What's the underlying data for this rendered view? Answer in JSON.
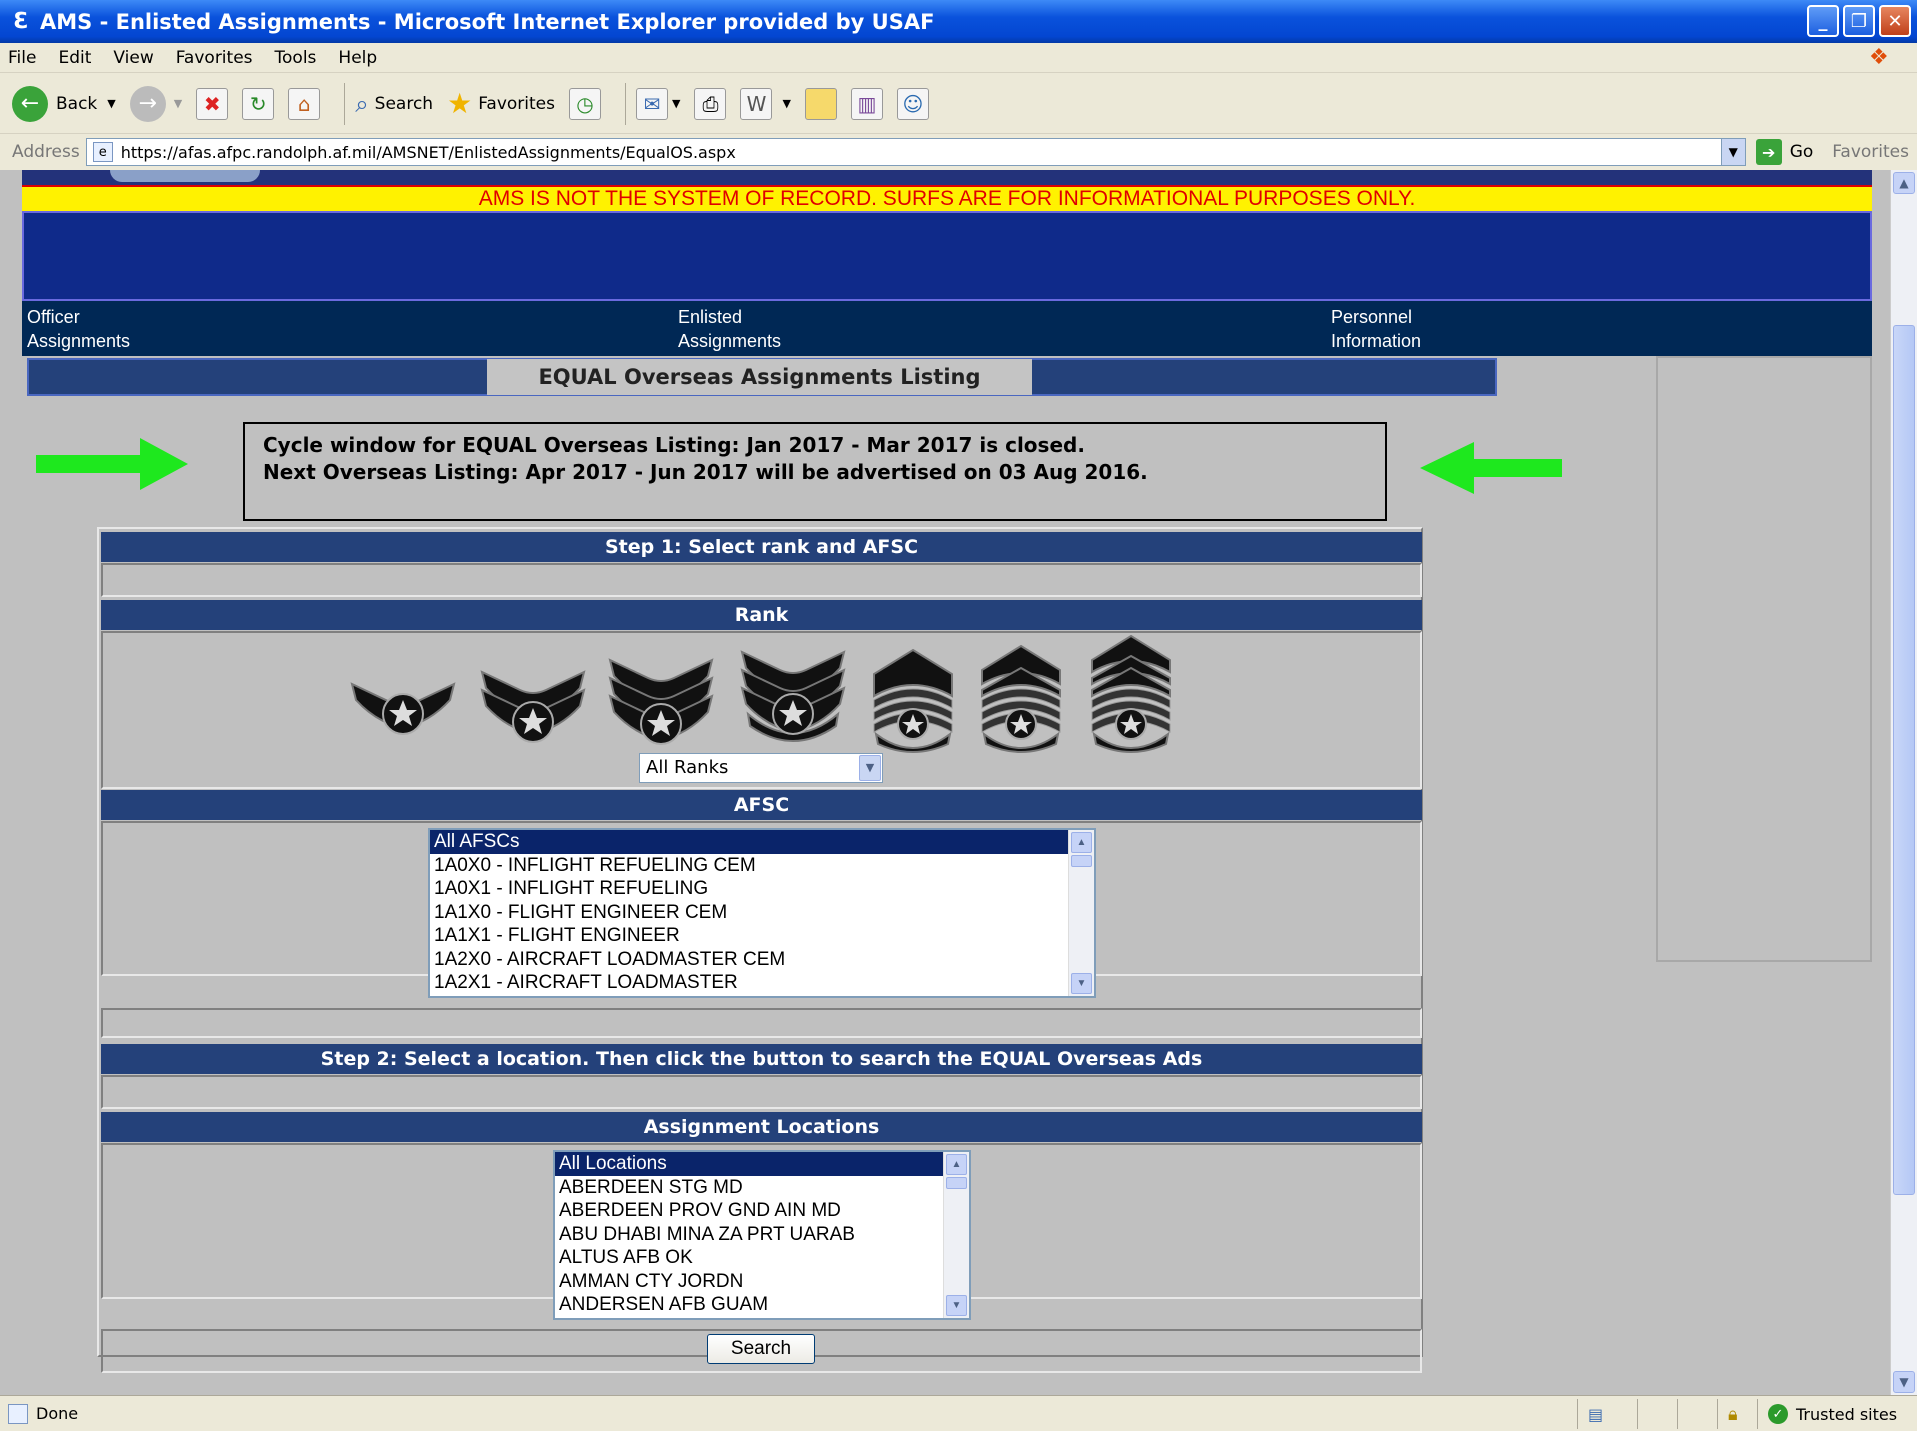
{
  "window": {
    "title": "AMS - Enlisted Assignments - Microsoft Internet Explorer provided by USAF"
  },
  "menu": [
    "File",
    "Edit",
    "View",
    "Favorites",
    "Tools",
    "Help"
  ],
  "toolbar": {
    "back": "Back",
    "search": "Search",
    "favorites": "Favorites"
  },
  "address": {
    "label": "Address",
    "url": "https://afas.afpc.randolph.af.mil/AMSNET/EnlistedAssignments/EqualOS.aspx",
    "go": "Go",
    "favorites": "Favorites"
  },
  "page": {
    "warning": "AMS IS NOT THE SYSTEM OF RECORD. SURFS ARE FOR INFORMATIONAL PURPOSES ONLY.",
    "nav": [
      {
        "line1": "Officer",
        "line2": "Assignments"
      },
      {
        "line1": "Enlisted",
        "line2": "Assignments"
      },
      {
        "line1": "Personnel",
        "line2": "Information"
      }
    ],
    "title": "EQUAL Overseas Assignments Listing",
    "cycle_line1": "Cycle window for EQUAL Overseas Listing: Jan 2017 - Mar 2017 is closed.",
    "cycle_line2": "Next Overseas Listing: Apr 2017 - Jun 2017 will be advertised on 03 Aug 2016.",
    "step1": "Step 1: Select rank and AFSC",
    "rank_header": "Rank",
    "rank_selected": "All Ranks",
    "afsc_header": "AFSC",
    "afsc_options": [
      "All AFSCs",
      "1A0X0 - INFLIGHT REFUELING CEM",
      "1A0X1 - INFLIGHT REFUELING",
      "1A1X0 - FLIGHT ENGINEER CEM",
      "1A1X1 - FLIGHT ENGINEER",
      "1A2X0 - AIRCRAFT LOADMASTER CEM",
      "1A2X1 - AIRCRAFT LOADMASTER"
    ],
    "step2": "Step 2: Select a location. Then click the button to search the EQUAL Overseas Ads",
    "locations_header": "Assignment Locations",
    "location_options": [
      "All Locations",
      "ABERDEEN STG MD",
      "ABERDEEN PROV GND AIN MD",
      "ABU DHABI MINA ZA PRT UARAB",
      "ALTUS AFB OK",
      "AMMAN CTY JORDN",
      "ANDERSEN AFB GUAM"
    ],
    "search_button": "Search"
  },
  "status": {
    "text": "Done",
    "zone": "Trusted sites"
  },
  "colors": {
    "accent_blue": "#24417a",
    "warning_yellow": "#fff200",
    "warning_red": "#e00000",
    "nav_navy": "#002855",
    "arrow_green": "#1ee81e"
  }
}
